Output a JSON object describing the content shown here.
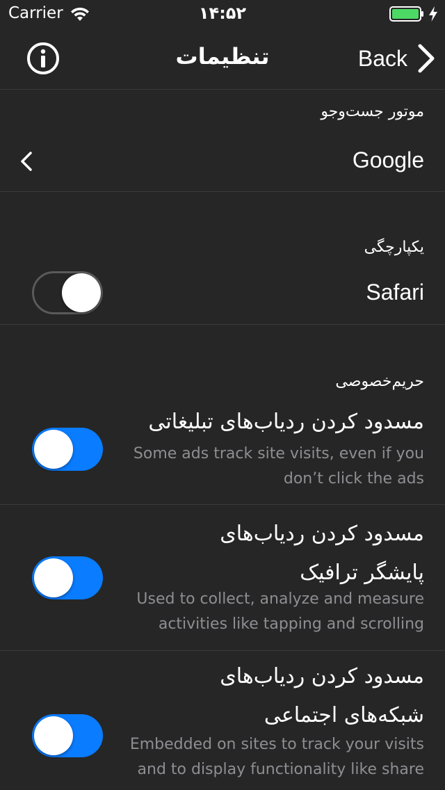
{
  "status_bar": {
    "carrier": "Carrier",
    "time": "۱۴:۵۲",
    "battery_color": "#4cd964"
  },
  "nav": {
    "title": "تنظیمات",
    "back_label": "Back",
    "info_icon": "info-circle-icon"
  },
  "search_engine": {
    "label": "موتور جست‌وجو",
    "value": "Google"
  },
  "integration": {
    "label": "یکپارچگی",
    "item": {
      "title": "Safari",
      "enabled": false
    }
  },
  "privacy": {
    "label": "حریم‌خصوصی",
    "items": [
      {
        "title": "مسدود کردن ردیاب‌های تبلیغاتی",
        "subtitle_line1": "Some ads track site visits, even if you",
        "subtitle_line2": "don’t click the ads",
        "enabled": true
      },
      {
        "title_line1": "مسدود کردن ردیاب‌های",
        "title_line2": "پایشگر ترافیک",
        "subtitle_line1": "Used to collect, analyze and measure",
        "subtitle_line2": "activities like tapping and scrolling",
        "enabled": true
      },
      {
        "title_line1": "مسدود کردن ردیاب‌های",
        "title_line2": "شبکه‌های اجتماعی",
        "subtitle_line1": "Embedded on sites to track your visits",
        "subtitle_line2": "and to display functionality like share",
        "enabled": true
      }
    ]
  },
  "colors": {
    "background": "#262626",
    "accent": "#0a7cff",
    "secondary_text": "#8e8e93"
  }
}
